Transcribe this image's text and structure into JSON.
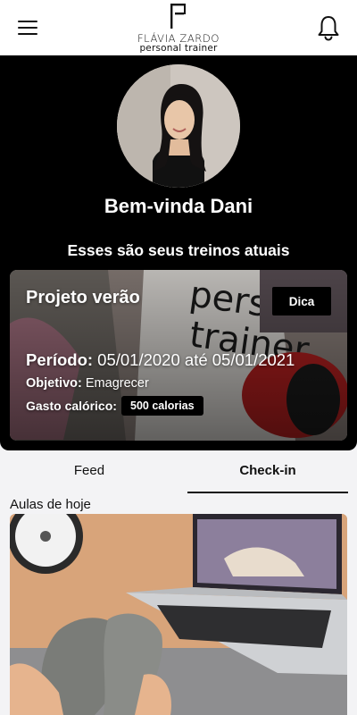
{
  "header": {
    "logo_mark": "F",
    "logo_name": "FLÁVIA ZARDO",
    "logo_subtitle": "personal trainer",
    "menu_icon": "hamburger-menu-icon",
    "notifications_icon": "bell-icon"
  },
  "hero": {
    "greeting": "Bem-vinda Dani",
    "subtitle": "Esses são seus treinos atuais"
  },
  "program": {
    "title": "Projeto verão",
    "tip_label": "Dica",
    "period_label": "Período:",
    "period_value": "05/01/2020 até 05/01/2021",
    "goal_label": "Objetivo:",
    "goal_value": "Emagrecer",
    "calories_label": "Gasto calórico:",
    "calories_value": "500 calorias"
  },
  "tabs": [
    {
      "label": "Feed",
      "active": false
    },
    {
      "label": "Check-in",
      "active": true
    }
  ],
  "today": {
    "section_label": "Aulas de hoje"
  },
  "colors": {
    "hero_background": "#000000",
    "page_background": "#f3f3f5",
    "badge_background": "#000000"
  }
}
